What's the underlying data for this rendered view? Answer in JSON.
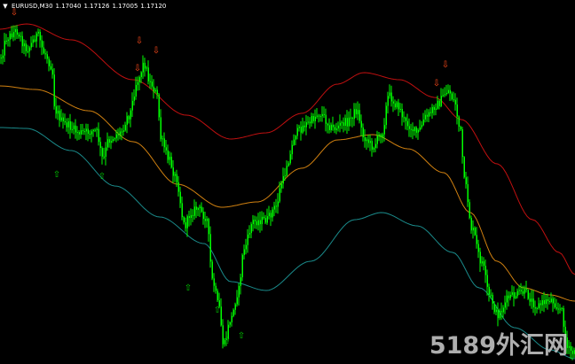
{
  "window": {
    "symbol_timeframe": "EURUSD,M30",
    "ohlc": [
      "1.17040",
      "1.17126",
      "1.17005",
      "1.17120"
    ],
    "collapse_icon": "triangle-down-icon"
  },
  "watermark": {
    "text": "5189外汇网"
  },
  "colors": {
    "background": "#000000",
    "candles": "#00ff00",
    "band_upper": "#c01010",
    "band_middle": "#d08010",
    "band_lower": "#1a8a8a",
    "sell_arrow": "#ff4a1a",
    "buy_arrow": "#00cc00"
  },
  "signals": {
    "sell_symbol": "⇩",
    "buy_symbol": "⇧"
  }
}
